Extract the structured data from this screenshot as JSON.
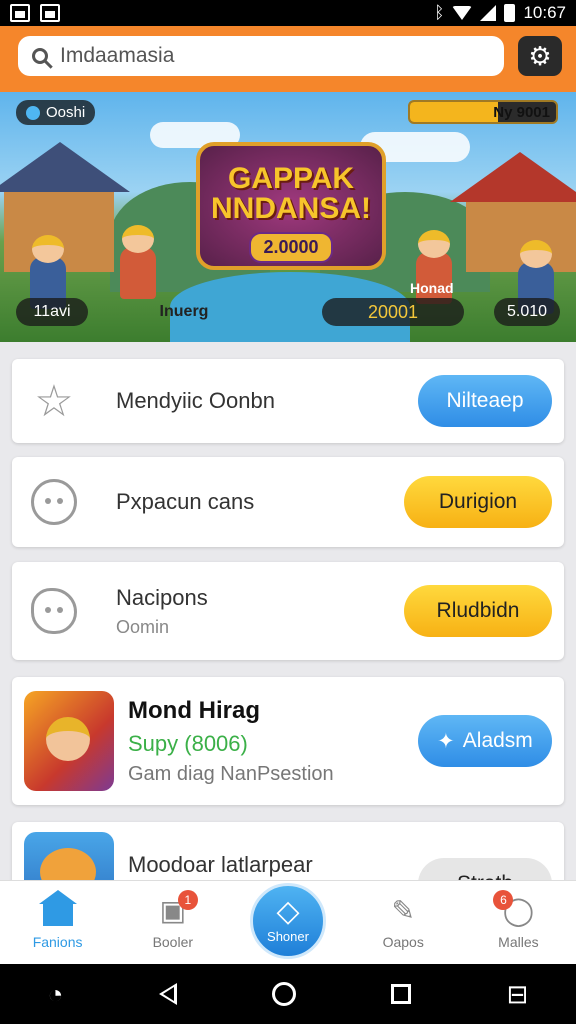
{
  "status_bar": {
    "time": "10:67",
    "bluetooth_icon": "bluetooth-icon",
    "wifi_icon": "wifi-icon",
    "signal_icon": "signal-icon",
    "battery_icon": "battery-icon"
  },
  "header": {
    "search_text": "Imdaamasia",
    "search_icon": "search-icon",
    "settings_icon": "gear-icon",
    "accent": "#f5862b"
  },
  "banner": {
    "top_left_badge": "Ooshi",
    "progress_label": "Ny 9001",
    "progress_value": 0.6,
    "logo_line1": "GAPPAK",
    "logo_line2": "NNDANSA!",
    "logo_sub": "2.0000",
    "stat_left": "11avi",
    "stat_left_mid": "Inuerg",
    "stat_center": "20001",
    "stat_right": "5.010",
    "overlay_label": "Honad"
  },
  "cards": [
    {
      "title": "Mendyiic Oonbn",
      "button": "Nilteaep",
      "icon": "star-icon"
    },
    {
      "title": "Pxpacun cans",
      "button": "Durigion",
      "icon": "face-icon"
    },
    {
      "title": "Nacipons",
      "subtitle": "Oomin",
      "button": "Rludbidn",
      "icon": "cloud-face-icon"
    },
    {
      "title": "Mond Hirag",
      "subtitle_green": "Supy (8006)",
      "subtitle_grey": "Gam diag NanPsestion",
      "button": "Aladsm",
      "button_icon": "sparkle-icon"
    },
    {
      "title": "Moodoar latlarpear",
      "button": "Stratb"
    }
  ],
  "bottom_nav": [
    {
      "label": "Fanions",
      "icon": "home-icon",
      "active": true
    },
    {
      "label": "Booler",
      "icon": "box-icon",
      "badge": "1"
    },
    {
      "label": "Shoner",
      "icon": "diamond-icon"
    },
    {
      "label": "Oapos",
      "icon": "pen-icon"
    },
    {
      "label": "Malles",
      "icon": "ring-icon",
      "badge": "6"
    }
  ]
}
